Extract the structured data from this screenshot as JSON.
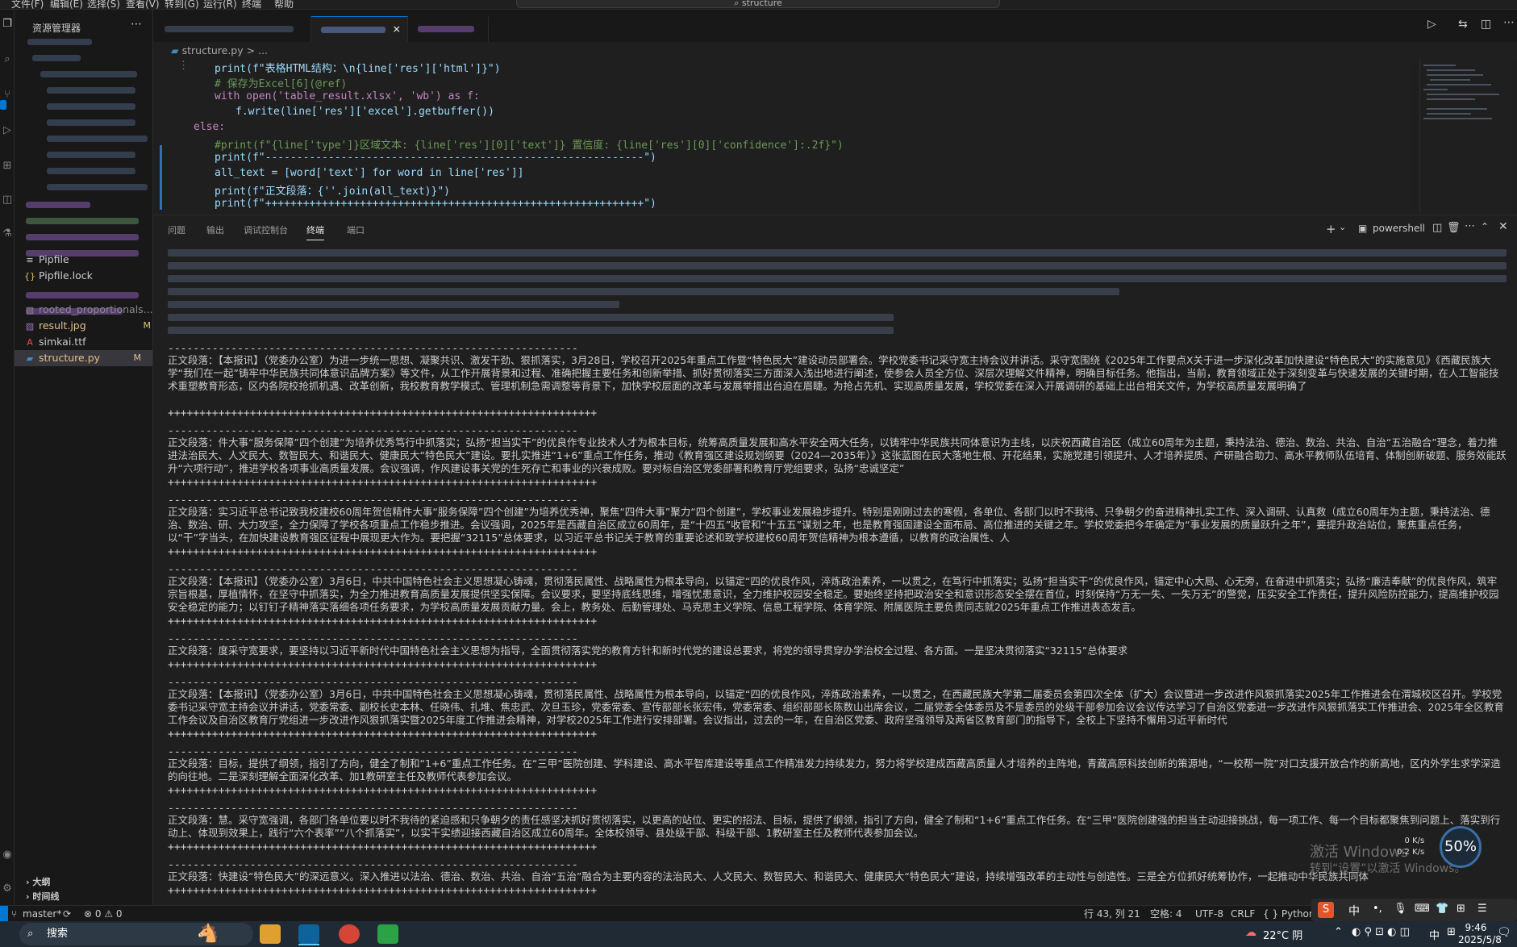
{
  "titlebar": {
    "menu": [
      "文件(F)",
      "编辑(E)",
      "选择(S)",
      "查看(V)",
      "转到(G)",
      "运行(R)",
      "终端",
      "帮助"
    ],
    "command_center": "structure"
  },
  "sidebar": {
    "header": "资源管理器",
    "files": [
      {
        "name": "Pipfile",
        "icon": "≡",
        "color": "#cccccc",
        "badge": ""
      },
      {
        "name": "Pipfile.lock",
        "icon": "{}",
        "color": "#cccccc",
        "badge": ""
      },
      {
        "name": "result.jpg",
        "icon": "▨",
        "color": "#cccccc",
        "badge": "M"
      },
      {
        "name": "simkai.ttf",
        "icon": "A",
        "color": "#cccccc",
        "badge": ""
      },
      {
        "name": "structure.py",
        "icon": "▰",
        "color": "#cccccc",
        "badge": "M"
      }
    ],
    "partial_items": [
      {
        "name": "rooted_proportionals...",
        "badge": ""
      }
    ],
    "sections": [
      "大纲",
      "时间线"
    ]
  },
  "tabs": [
    {
      "label": "structure.py",
      "active": true,
      "close": "×"
    },
    {
      "label": "",
      "active": false,
      "close": ""
    },
    {
      "label": "",
      "active": false,
      "close": ""
    }
  ],
  "breadcrumb": {
    "file": "structure.py",
    "sep": ">",
    "more": "..."
  },
  "code": {
    "lines": [
      {
        "num": "",
        "indent": 76,
        "html": "print(f\"表格HTML结构：\\n{line['res']['html']}\")"
      },
      {
        "num": "",
        "indent": 76,
        "html": "# 保存为Excel[6](@ref)"
      },
      {
        "num": "",
        "indent": 76,
        "html": "with open('table_result.xlsx', 'wb') as f:"
      },
      {
        "num": "",
        "indent": 102,
        "html": "f.write(line['res']['excel'].getbuffer())"
      },
      {
        "num": "",
        "indent": 50,
        "html": "else:"
      },
      {
        "num": "",
        "indent": 76,
        "html": "#print(f\"{line['type']}区域文本: {line['res'][0]['text']} 置信度: {line['res'][0]['confidence']:.2f}\")"
      },
      {
        "num": "",
        "indent": 76,
        "html": "print(f\"------------------------------------------------------------\")"
      },
      {
        "num": "",
        "indent": 76,
        "html": "all_text = [word['text'] for word in line['res']]"
      },
      {
        "num": "",
        "indent": 76,
        "html": "print(f\"正文段落：{''.join(all_text)}\")"
      },
      {
        "num": "",
        "indent": 76,
        "html": "print(f\"++++++++++++++++++++++++++++++++++++++++++++++++++++++++++++\")"
      }
    ]
  },
  "panel": {
    "tabs": [
      "问题",
      "输出",
      "调试控制台",
      "终端",
      "端口"
    ],
    "active_tab": "终端",
    "shell": "powershell",
    "plus": "+",
    "separator_dash": "-----------------------------------------------------------------",
    "separator_plus": "++++++++++++++++++++++++++++++++++++++++++++++++++++++++++++++++++++",
    "paragraphs": [
      "正文段落：【本报讯】（党委办公室）为进一步统一思想、凝聚共识、激发干劲、狠抓落实，3月28日，学校召开2025年重点工作暨“特色民大”建设动员部署会。学校党委书记采守宽主持会议并讲话。采守宽围绕《2025年工作要点X关于进一步深化改革加快建设“特色民大”的实施意见》《西藏民族大学“我们在一起”铸牢中华民族共同体意识品牌方案》等文件，从工作开展背景和过程、准确把握主要任务和创新举措、抓好贯彻落实三方面深入浅出地进行阐述，使参会人员全方位、深层次理解文件精神，明确目标任务。他指出，当前，教育领域正处于深刻变革与快速发展的关键时期，在人工智能技术重塑教育形态，区内各院校抢抓机遇、改革创新，我校教育教学模式、管理机制急需调整等背景下，加快学校层面的改革与发展举措出台迫在眉睫。为抢占先机、实现高质量发展，学校党委在深入开展调研的基础上出台相关文件，为学校高质量发展明确了",
      "正文段落：件大事“服务保障”四个创建”为培养优秀笃行中抓落实；弘扬“担当实干”的优良作专业技术人才为根本目标，统筹高质量发展和高水平安全两大任务，以铸牢中华民族共同体意识为主线，以庆祝西藏自治区（成立60周年为主题，秉持法治、德治、数治、共治、自治“五治融合”理念，着力推进法治民大、人文民大、数智民大、和谐民大、健康民大“特色民大”建设。要扎实推进“1+6”重点工作任务，推动《教育强区建设规划纲要（2024—2035年）》这张蓝图在民大落地生根、开花结果，实施党建引领提升、人才培养提质、产研融合助力、高水平教师队伍培育、体制创新破题、服务效能跃升“六项行动”，推进学校各项事业高质量发展。会议强调，作风建设事关党的生死存亡和事业的兴衰成败。要对标自治区党委部署和教育厅党组要求，弘扬“忠诚坚定”",
      "正文段落：实习近平总书记致我校建校60周年贺信精件大事“服务保障”四个创建”为培养优秀神，聚焦“四件大事”聚力“四个创建”，学校事业发展稳步提升。特别是刚刚过去的寒假，各单位、各部门以时不我待、只争朝夕的奋进精神扎实工作、深入调研、认真救（成立60周年为主题，秉持法治、德治、数治、研、大力攻坚，全力保障了学校各项重点工作稳步推进。会议强调，2025年是西藏自治区成立60周年，是“十四五”收官和“十五五”谋划之年，也是教育强国建设全面布局、高位推进的关键之年。学校党委把今年确定为“事业发展的质量跃升之年”，要提升政治站位，聚焦重点任务，以“干”字当头，在加快建设教育强区征程中展现更大作为。要把握“32115”总体要求，以习近平总书记关于教育的重要论述和致学校建校60周年贺信精神为根本遵循，以教育的政治属性、人",
      "正文段落：【本报讯】（党委办公室）3月6日，中共中国特色社会主义思想凝心铸魂，贯彻落民属性、战略属性为根本导向，以锚定“四的优良作风，淬炼政治素养，一以贯之，在笃行中抓落实；弘扬“担当实干”的优良作风，锚定中心大局、心无旁，在奋进中抓落实；弘扬“廉洁奉献”的优良作风，筑牢宗旨根基，厚植情怀，在坚守中抓落实，为全力推进教育高质量发展提供坚实保障。会议要求，要坚持底线思维，增强忧患意识，全力维护校园安全稳定。要始终坚持把政治安全和意识形态安全摆在首位，时刻保持“万无一失、一失万无”的警觉，压实安全工作责任，提升风险防控能力，提高维护校园安全稳定的能力；以钉钉子精神落实落细各项任务要求，为学校高质量发展贡献力量。会上，教务处、后勤管理处、马克思主义学院、信息工程学院、体育学院、附属医院主要负责同志就2025年重点工作推进表态发言。",
      "正文段落：度采守宽要求，要坚持以习近平新时代中国特色社会主义思想为指导，全面贯彻落实党的教育方针和新时代党的建设总要求，将党的领导贯穿办学治校全过程、各方面。一是坚决贯彻落实“32115”总体要求",
      "正文段落：【本报讯】（党委办公室）3月6日，中共中国特色社会主义思想凝心铸魂，贯彻落民属性、战略属性为根本导向，以锚定“四的优良作风，淬炼政治素养，一以贯之，在西藏民族大学第二届委员会第四次全体（扩大）会议暨进一步改进作风狠抓落实2025年工作推进会在渭城校区召开。学校党委书记采守宽主持会议并讲话，党委常委、副校长史本林、任晓伟、扎堆、焦忠武、次旦玉珍，党委常委、宣传部部长张宏伟，党委常委、组织部部长陈数山出席会议，二届党委全体委员及不是委员的处级干部参加会议会议传达学习了自治区党委进一步改进作风狠抓落实工作推进会、2025年全区教育工作会议及自治区教育厅党组进一步改进作风狠抓落实暨2025年度工作推进会精神，对学校2025年工作进行安排部署。会议指出，过去的一年，在自治区党委、政府坚强领导及两省区教育部门的指导下，全校上下坚持不懈用习近平新时代",
      "正文段落：目标，提供了纲领，指引了方向，健全了制和“1+6”重点工作任务。在“三甲”医院创建、学科建设、高水平智库建设等重点工作精准发力持续发力，努力将学校建成西藏高质量人才培养的主阵地，青藏高原科技创新的策源地，“一校帮一院”对口支援开放合作的新高地，区内外学生求学深造的向往地。二是深刻理解全面深化改革、加1教研室主任及教师代表参加会议。",
      "正文段落：慧。采守宽强调，各部门各单位要以时不我待的紧迫感和只争朝夕的责任感坚决抓好贯彻落实，以更高的站位、更实的招法、目标，提供了纲领，指引了方向，健全了制和“1+6”重点工作任务。在“三甲”医院创建强的担当主动迎接挑战，每一项工作、每一个目标都聚焦到问题上、落实到行动上、体现到效果上，践行“六个表率”“八个抓落实”，以实干实绩迎接西藏自治区成立60周年。全体校领导、县处级干部、科级干部、1教研室主任及教师代表参加会议。",
      "正文段落：快建设“特色民大”的深远意义。深入推进以法治、德治、数治、共治、自治“五治”融合为主要内容的法治民大、人文民大、数智民大、和谐民大、健康民大“特色民大”建设，持续增强改革的主动性与创造性。三是全方位抓好统筹协作，一起推动中华民族共同体"
    ]
  },
  "status": {
    "branch": "master*",
    "sync": "⟳",
    "errors": "⊗ 0 ⚠ 0",
    "cursor": "行 43, 列 21",
    "spaces": "空格: 4",
    "encoding": "UTF-8",
    "eol": "CRLF",
    "language": "{ } Python"
  },
  "taskbar": {
    "search": "搜索",
    "weather": "22°C 阴",
    "ime": "中",
    "time": "9:46",
    "date": "2025/5/8"
  },
  "overlay": {
    "watermark_line1": "激活 Windows",
    "watermark_line2": "转到“设置”以激活 Windows。",
    "gauge_percent": "50%",
    "net_up": "0 K/s",
    "net_down": "0.2 K/s"
  }
}
